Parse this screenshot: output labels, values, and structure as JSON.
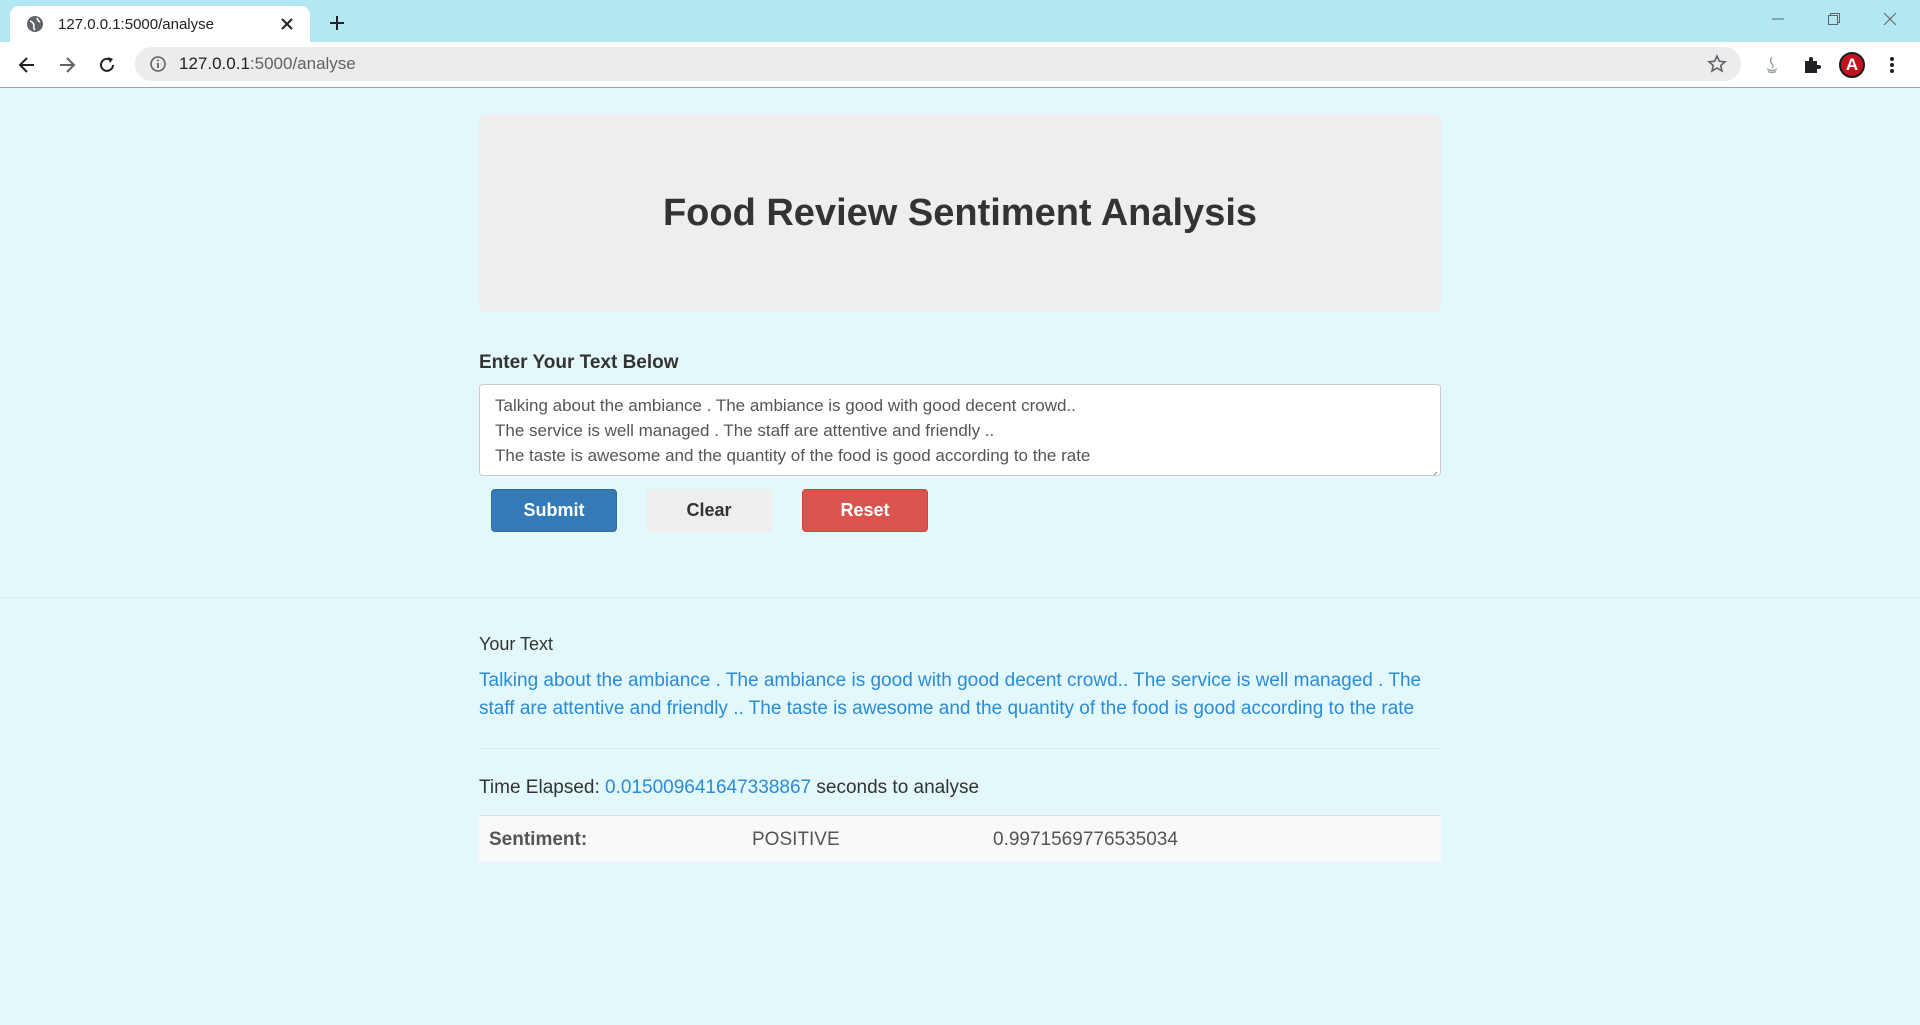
{
  "browser": {
    "tab_title": "127.0.0.1:5000/analyse",
    "url_host": "127.0.0.1",
    "url_path": ":5000/analyse",
    "profile_initial": "A"
  },
  "page": {
    "heading": "Food Review Sentiment Analysis",
    "form_label": "Enter Your Text Below",
    "input_lines": [
      "Talking about the ambiance . The ambiance is good with good decent crowd..",
      "The service is well managed . The staff are attentive and friendly ..",
      "The taste is awesome and the quantity of the food is good according to the rate"
    ],
    "buttons": {
      "submit": "Submit",
      "clear": "Clear",
      "reset": "Reset"
    },
    "your_text_label": "Your Text",
    "your_text": "Talking about the ambiance . The ambiance is good with good decent crowd.. The service is well managed . The staff are attentive and friendly .. The taste is awesome and the quantity of the food is good according to the rate",
    "elapsed_prefix": "Time Elapsed:",
    "elapsed_value": "0.015009641647338867",
    "elapsed_suffix": "seconds to analyse",
    "result": {
      "label": "Sentiment:",
      "sentiment": "POSITIVE",
      "score": "0.9971569776535034"
    }
  },
  "colors": {
    "page_bg": "#e3f8fb",
    "tabbar_bg": "#b3e7f1",
    "submit": "#337ab7",
    "reset": "#d9534f",
    "link_text": "#2a8bd6"
  }
}
